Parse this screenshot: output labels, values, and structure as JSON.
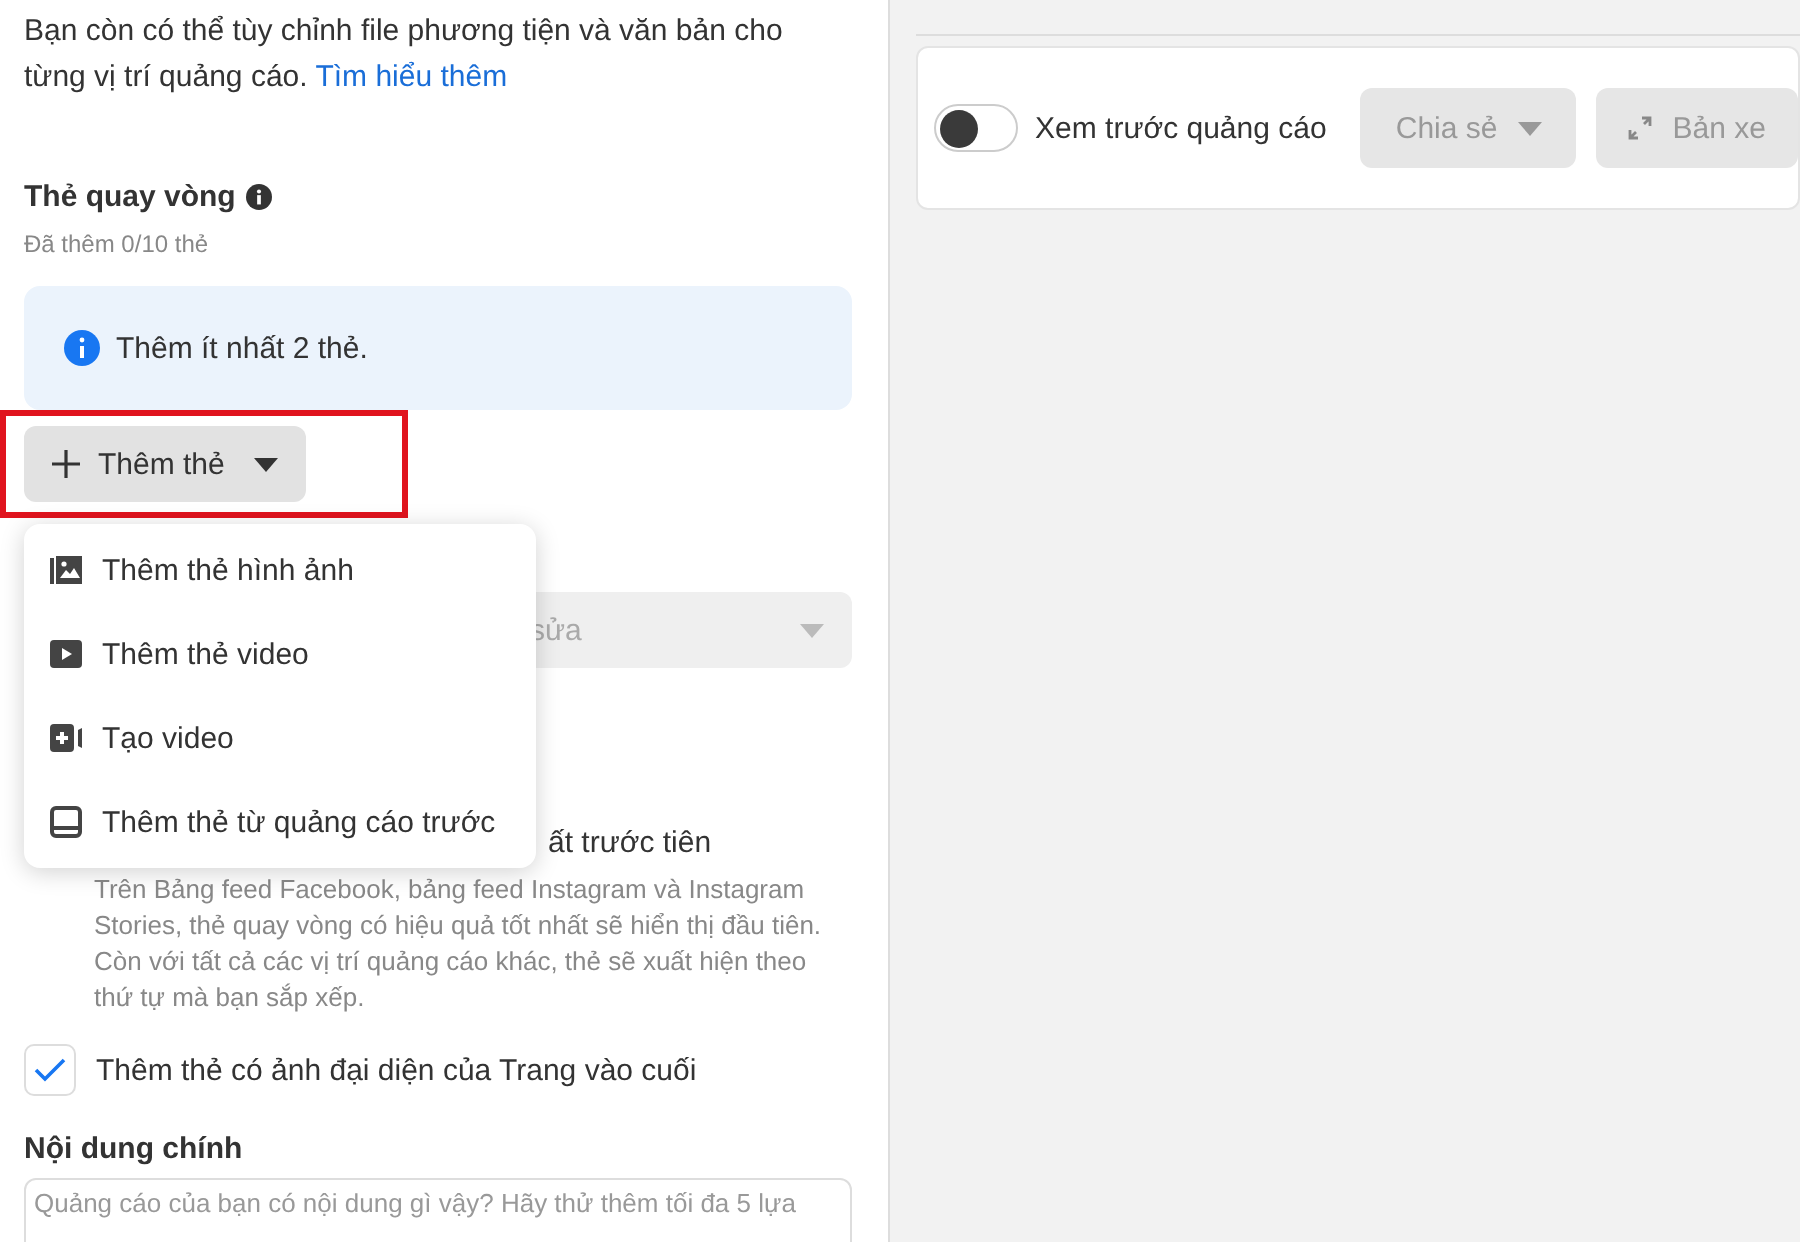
{
  "intro": {
    "text": "Bạn còn có thể tùy chỉnh file phương tiện và văn bản cho từng vị trí quảng cáo.",
    "link": "Tìm hiểu thêm"
  },
  "carousel": {
    "title": "Thẻ quay vòng",
    "count": "Đã thêm 0/10 thẻ",
    "notice": "Thêm ít nhất 2 thẻ."
  },
  "add_card_button": {
    "label": "Thêm thẻ",
    "highlighted": true
  },
  "add_card_menu": [
    {
      "kind": "image",
      "label": "Thêm thẻ hình ảnh"
    },
    {
      "kind": "video",
      "label": "Thêm thẻ video"
    },
    {
      "kind": "create-video",
      "label": "Tạo video"
    },
    {
      "kind": "previous-ad",
      "label": "Thêm thẻ từ quảng cáo trước"
    }
  ],
  "select_field": {
    "value": "sửa"
  },
  "order_option": {
    "label": "ất trước tiên",
    "description": "Trên Bảng feed Facebook, bảng feed Instagram và Instagram Stories, thẻ quay vòng có hiệu quả tốt nhất sẽ hiển thị đầu tiên. Còn với tất cả các vị trí quảng cáo khác, thẻ sẽ xuất hiện theo thứ tự mà bạn sắp xếp."
  },
  "page_card_option": {
    "label": "Thêm thẻ có ảnh đại diện của Trang vào cuối",
    "checked": true
  },
  "primary_text": {
    "title": "Nội dung chính",
    "placeholder": "Quảng cáo của bạn có nội dung gì vậy? Hãy thử thêm tối đa 5 lựa"
  },
  "preview_bar": {
    "toggle_label": "Xem trước quảng cáo",
    "on": false,
    "share_button": "Chia sẻ",
    "preview_button": "Bản xe"
  }
}
